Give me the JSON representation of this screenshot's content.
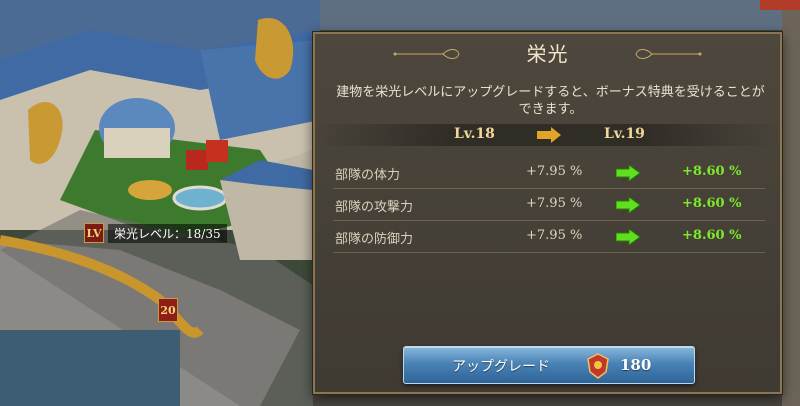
{
  "background": {
    "level_tag": {
      "icon_label": "LV",
      "label": "栄光レベル：",
      "value": "18/35"
    },
    "flag_number": "20"
  },
  "panel": {
    "title": "栄光",
    "description": "建物を栄光レベルにアップグレードすると、ボーナス特典を受けることができます。",
    "level_from": "Lv.18",
    "level_to": "Lv.19",
    "stats": [
      {
        "name": "部隊の体力",
        "current": "+7.95 %",
        "next": "+8.60 %"
      },
      {
        "name": "部隊の攻撃力",
        "current": "+7.95 %",
        "next": "+8.60 %"
      },
      {
        "name": "部隊の防御力",
        "current": "+7.95 %",
        "next": "+8.60 %"
      }
    ],
    "upgrade_button": {
      "label": "アップグレード",
      "cost": "180",
      "cost_icon": "gem-crest-icon"
    }
  },
  "colors": {
    "panel_bg": "#4d473d",
    "panel_border": "#8a7650",
    "stat_increase": "#7bea2a",
    "button_blue": "#4a83b6"
  }
}
